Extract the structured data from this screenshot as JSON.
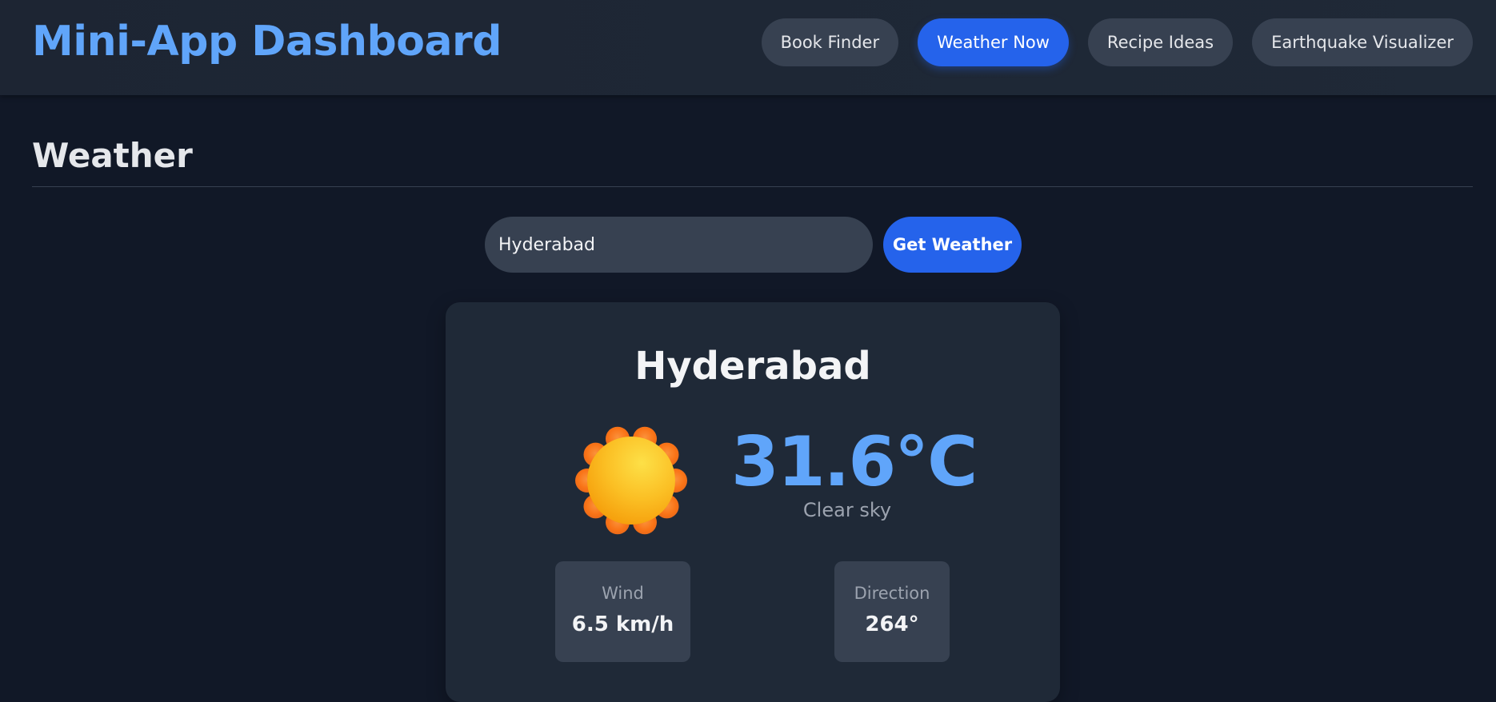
{
  "header": {
    "title": "Mini-App Dashboard",
    "nav": [
      {
        "label": "Book Finder",
        "active": false
      },
      {
        "label": "Weather Now",
        "active": true
      },
      {
        "label": "Recipe Ideas",
        "active": false
      },
      {
        "label": "Earthquake Visualizer",
        "active": false
      }
    ]
  },
  "section": {
    "title": "Weather"
  },
  "search": {
    "value": "Hyderabad",
    "button_label": "Get Weather"
  },
  "weather": {
    "city": "Hyderabad",
    "icon": "sun-icon",
    "temperature": "31.6°C",
    "condition": "Clear sky",
    "wind_label": "Wind",
    "wind_value": "6.5 km/h",
    "direction_label": "Direction",
    "direction_value": "264°"
  },
  "colors": {
    "background": "#111827",
    "header": "#1f2937",
    "accent": "#2563eb",
    "title": "#60a5fa",
    "card": "#1f2937",
    "chip": "#374151"
  }
}
